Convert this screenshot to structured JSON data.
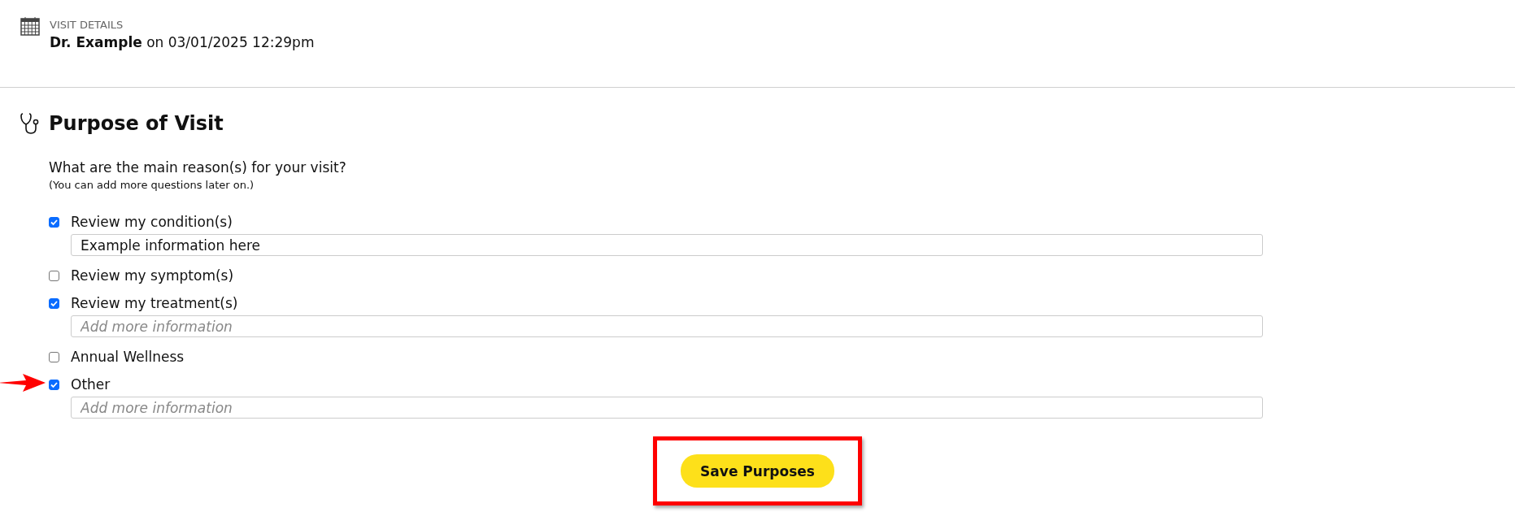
{
  "visit_details": {
    "label": "VISIT DETAILS",
    "summary": "**Dr. Example** on 03/01/2025 12:29pm"
  },
  "purpose": {
    "title": "Purpose of Visit",
    "question": "What are the main reason(s) for your visit?",
    "hint": "(You can add more questions later on.)",
    "items": [
      {
        "label": "Review my condition(s)",
        "checked": true,
        "marked": false,
        "field": {
          "value": "Example information here"
        }
      },
      {
        "label": "Review my symptom(s)",
        "checked": false,
        "marked": false
      },
      {
        "label": "Review my treatment(s)",
        "checked": true,
        "marked": false,
        "field": {
          "placeholder": "Add more information"
        }
      },
      {
        "label": "Annual Wellness",
        "checked": false,
        "marked": false
      },
      {
        "label": "Other",
        "checked": true,
        "marked": true,
        "field": {
          "placeholder": "Add more information"
        }
      }
    ],
    "save_button": {
      "label": "Save Purposes",
      "highlighted": true
    }
  }
}
